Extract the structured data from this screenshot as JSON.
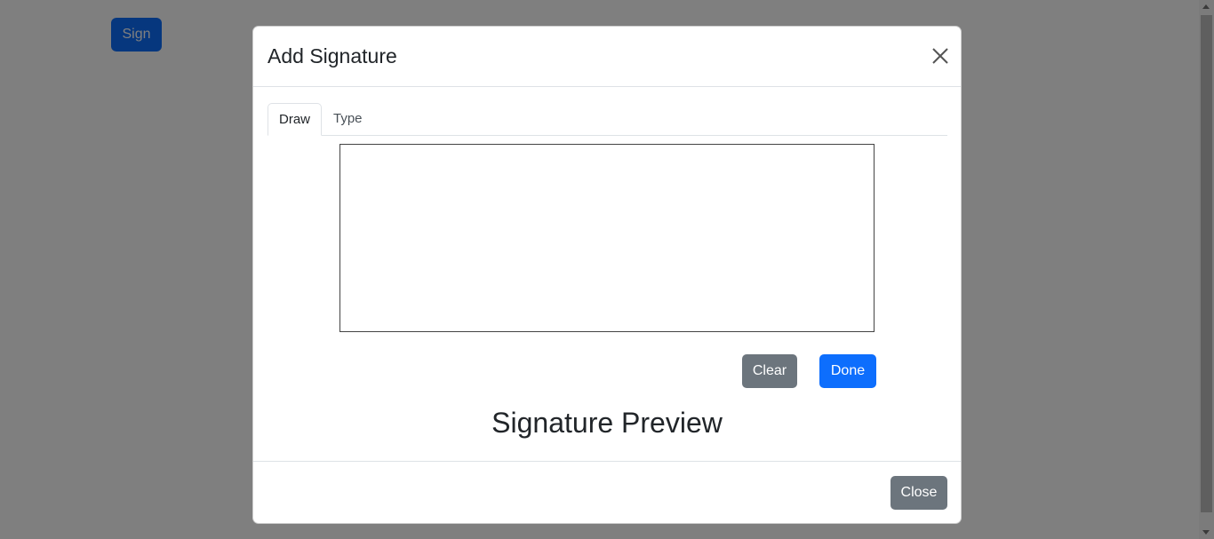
{
  "page": {
    "sign_button_label": "Sign"
  },
  "modal": {
    "title": "Add Signature",
    "close_icon": "close-icon",
    "tabs": [
      {
        "label": "Draw",
        "active": true
      },
      {
        "label": "Type",
        "active": false
      }
    ],
    "clear_label": "Clear",
    "done_label": "Done",
    "preview_title": "Signature Preview",
    "footer_close_label": "Close"
  },
  "colors": {
    "primary": "#0d6efd",
    "secondary": "#6c757d",
    "backdrop": "rgba(0,0,0,0.5)"
  }
}
